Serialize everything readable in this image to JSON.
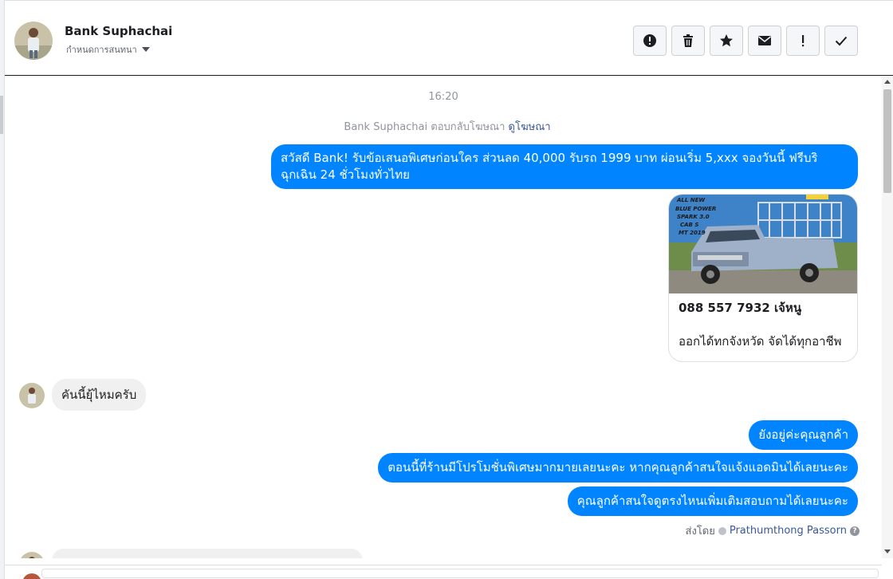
{
  "header": {
    "name": "Bank Suphachai",
    "subtitle": "กำหนดการสนทนา"
  },
  "thread": {
    "time": "16:20",
    "meta_text": "Bank Suphachai ตอบกลับโฆษณา",
    "meta_link": "ดูโฆษณา",
    "outgoing_1": "สวัสดี Bank! รับข้อเสนอพิเศษก่อนใคร ส่วนลด 40,000 รับรถ 1999 บาท ผ่อนเริ่ม 5,xxx จองวันนี้ ฟรีบริฉุกเฉิน 24 ชั่วโมงทั่วไทย",
    "card": {
      "image_text": [
        "ALL NEW",
        "BLUE POWER",
        "SPARK 3.0",
        "CAB S",
        "MT 2019"
      ],
      "title": "088 557 7932 เจ้หนู",
      "description": "ออกได้ทกจังหวัด จัดได้ทุกอาชีพ"
    },
    "incoming_1": "คันนี้ยุ้ไหมครับ",
    "outgoing_2": "ยังอยู่ค่ะคุณลูกค้า",
    "outgoing_3": "ตอนนี้ที่ร้านมีโปรโมชั่นพิเศษมากมายเลยนะคะ หากคุณลูกค้าสนใจแจ้งแอดมินได้เลยนะคะ",
    "outgoing_4": "คุณลูกค้าสนใจดูตรงไหนเพิ่มเติมสอบถามได้เลยนะคะ",
    "sent_by_prefix": "ส่งโดย",
    "sent_by_name": "Prathumthong Passorn",
    "help_glyph": "?"
  },
  "colors": {
    "outgoing_bubble": "#0084ff",
    "incoming_bubble": "#f0f0f0",
    "link": "#385898"
  },
  "icons": {
    "toolbar": [
      "alert-circle-icon",
      "trash-icon",
      "star-icon",
      "envelope-icon",
      "exclamation-icon",
      "checkmark-icon"
    ]
  }
}
